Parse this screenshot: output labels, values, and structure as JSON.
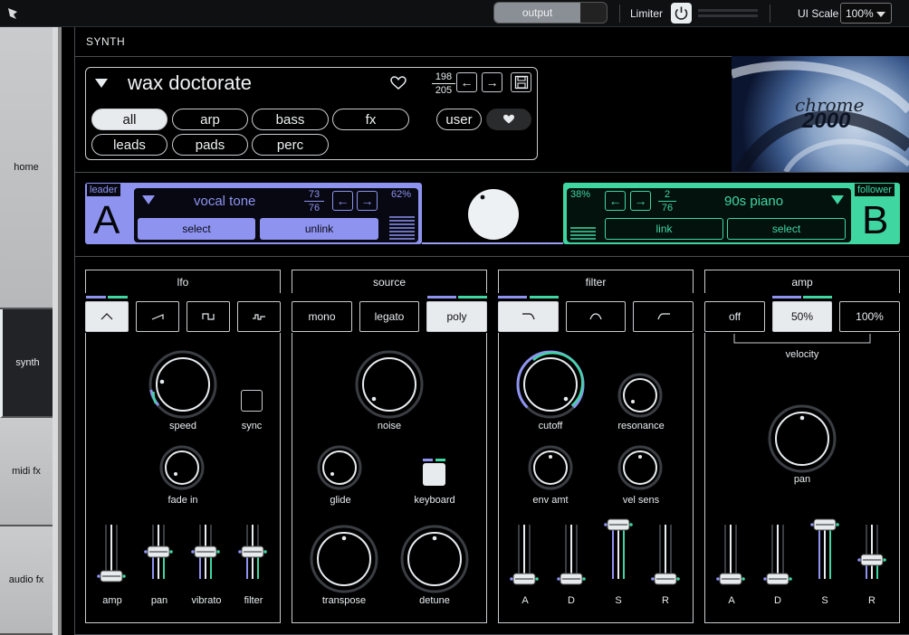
{
  "topbar": {
    "output_label": "output",
    "limiter_label": "Limiter",
    "ui_scale_label": "UI Scale",
    "ui_scale_value": "100%"
  },
  "sidebar": {
    "items": [
      {
        "label": "home"
      },
      {
        "label": "synth"
      },
      {
        "label": "midi fx"
      },
      {
        "label": "audio fx"
      }
    ]
  },
  "page_title": "SYNTH",
  "preset": {
    "name": "wax doctorate",
    "index": "198",
    "total": "205",
    "categories": [
      "all",
      "arp",
      "bass",
      "fx",
      "leads",
      "pads",
      "perc"
    ],
    "user_label": "user",
    "selected_category": "all"
  },
  "brand": {
    "text_top": "chrome",
    "text_bottom": "2000"
  },
  "leader": {
    "tag": "leader",
    "letter": "A",
    "name": "vocal tone",
    "index": "73",
    "total": "76",
    "percent": "62%",
    "select_label": "select",
    "unlink_label": "unlink",
    "color": "#8e93f0"
  },
  "follower": {
    "tag": "follower",
    "letter": "B",
    "name": "90s piano",
    "index": "2",
    "total": "76",
    "percent": "38%",
    "link_label": "link",
    "select_label": "select",
    "color": "#3fd6a2"
  },
  "lfo": {
    "title": "lfo",
    "speed_label": "speed",
    "sync_label": "sync",
    "fade_label": "fade in",
    "sliders": [
      {
        "label": "amp",
        "value": 0.05
      },
      {
        "label": "pan",
        "value": 0.5
      },
      {
        "label": "vibrato",
        "value": 0.5
      },
      {
        "label": "filter",
        "value": 0.5
      }
    ]
  },
  "source": {
    "title": "source",
    "modes": [
      "mono",
      "legato",
      "poly"
    ],
    "selected_mode": "poly",
    "noise_label": "noise",
    "glide_label": "glide",
    "keyboard_label": "keyboard",
    "transpose_label": "transpose",
    "detune_label": "detune"
  },
  "filter": {
    "title": "filter",
    "cutoff_label": "cutoff",
    "resonance_label": "resonance",
    "env_label": "env amt",
    "vel_label": "vel sens",
    "sliders": [
      {
        "label": "A",
        "value": 0.0
      },
      {
        "label": "D",
        "value": 0.0
      },
      {
        "label": "S",
        "value": 1.0
      },
      {
        "label": "R",
        "value": 0.0
      }
    ]
  },
  "amp": {
    "title": "amp",
    "modes": [
      "off",
      "50%",
      "100%"
    ],
    "selected_mode": "50%",
    "velocity_label": "velocity",
    "pan_label": "pan",
    "sliders": [
      {
        "label": "A",
        "value": 0.0
      },
      {
        "label": "D",
        "value": 0.0
      },
      {
        "label": "S",
        "value": 1.0
      },
      {
        "label": "R",
        "value": 0.35
      }
    ]
  }
}
